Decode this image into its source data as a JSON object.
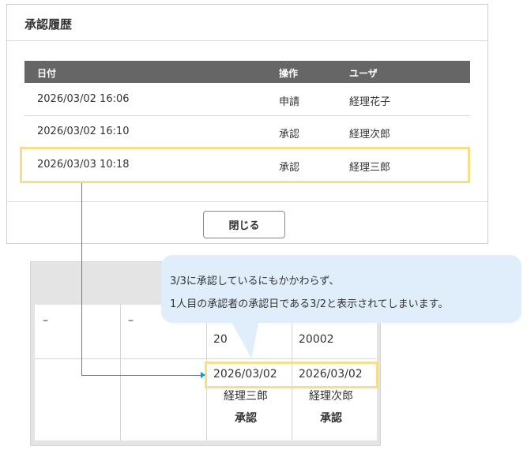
{
  "dialog": {
    "title": "承認履歴",
    "headers": {
      "date": "日付",
      "operation": "操作",
      "user": "ユーザ"
    },
    "rows": [
      {
        "date": "2026/03/02  16:06",
        "operation": "申請",
        "user": "経理花子"
      },
      {
        "date": "2026/03/02  16:10",
        "operation": "承認",
        "user": "経理次郎"
      },
      {
        "date": "2026/03/03  10:18",
        "operation": "承認",
        "user": "経理三郎"
      }
    ],
    "close_label": "閉じる"
  },
  "lower_table": {
    "dash1": "–",
    "dash2": "–",
    "partial_code1": "20",
    "code2": "20002",
    "date1": "2026/03/02",
    "date2": "2026/03/02",
    "approver1": "経理三郎",
    "approver2": "経理次郎",
    "status1": "承認",
    "status2": "承認"
  },
  "callout": {
    "line1": "3/3に承認しているにもかかわらず、",
    "line2": "1人目の承認者の承認日である3/2と表示されてしまいます。"
  },
  "colors": {
    "highlight": "#f5df8b",
    "connector": "#1f8fd6",
    "callout_bg": "#dfeefa",
    "table_header_bg": "#666666"
  }
}
